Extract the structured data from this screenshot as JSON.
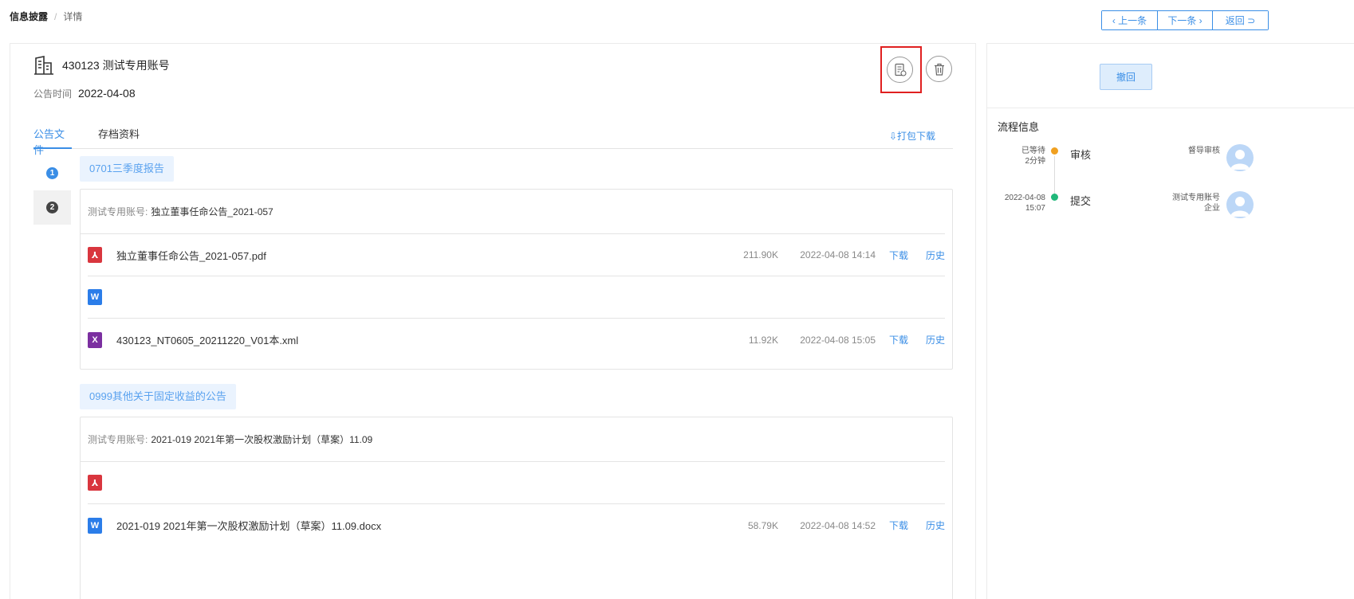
{
  "breadcrumb": {
    "root": "信息披露",
    "separator": "/",
    "current": "详情"
  },
  "top_nav": {
    "prev": "‹ 上一条",
    "next": "下一条 ›",
    "back": "返回 ⊃"
  },
  "header": {
    "company": "430123  测试专用账号",
    "pubtime_label": "公告时间",
    "pubtime_value": "2022-04-08"
  },
  "tabs": [
    {
      "label": "公告文件"
    },
    {
      "label": "存档资料"
    }
  ],
  "bundle_download": "⇩打包下载",
  "steps": [
    "1",
    "2"
  ],
  "sections": [
    {
      "tag": "0701三季度报告",
      "account": "测试专用账号:",
      "title": "独立董事任命公告_2021-057",
      "files": [
        {
          "type": "pdf",
          "icon": "pdf-icon",
          "name": "独立董事任命公告_2021-057.pdf",
          "size": "211.90K",
          "date": "2022-04-08 14:14",
          "download": "下载",
          "history": "历史"
        },
        {
          "type": "word",
          "icon": "word-icon",
          "name": "",
          "size": "",
          "date": "",
          "download": "",
          "history": ""
        },
        {
          "type": "xml",
          "icon": "xml-icon",
          "name": "430123_NT0605_20211220_V01本.xml",
          "size": "11.92K",
          "date": "2022-04-08 15:05",
          "download": "下载",
          "history": "历史"
        }
      ]
    },
    {
      "tag": "0999其他关于固定收益的公告",
      "account": "测试专用账号:",
      "title": "2021-019 2021年第一次股权激励计划（草案）11.09",
      "files": [
        {
          "type": "pdf",
          "icon": "pdf-icon",
          "name": "",
          "size": "",
          "date": "",
          "download": "",
          "history": ""
        },
        {
          "type": "word",
          "icon": "word-icon",
          "name": "2021-019 2021年第一次股权激励计划（草案）11.09.docx",
          "size": "58.79K",
          "date": "2022-04-08 14:52",
          "download": "下载",
          "history": "历史"
        }
      ]
    }
  ],
  "side": {
    "withdraw": "撤回",
    "flow_title": "流程信息",
    "flow": [
      {
        "time_line1": "已等待",
        "time_line2": "2分钟",
        "step": "审核",
        "who_line1": "督导审核",
        "who_line2": "",
        "status_color": "#f0a020"
      },
      {
        "time_line1": "2022-04-08",
        "time_line2": "15:07",
        "step": "提交",
        "who_line1": "测试专用账号",
        "who_line2": "企业",
        "status_color": "#20b87a"
      }
    ]
  },
  "colors": {
    "accent": "#3a8ee6",
    "highlight_box": "#e02020"
  }
}
